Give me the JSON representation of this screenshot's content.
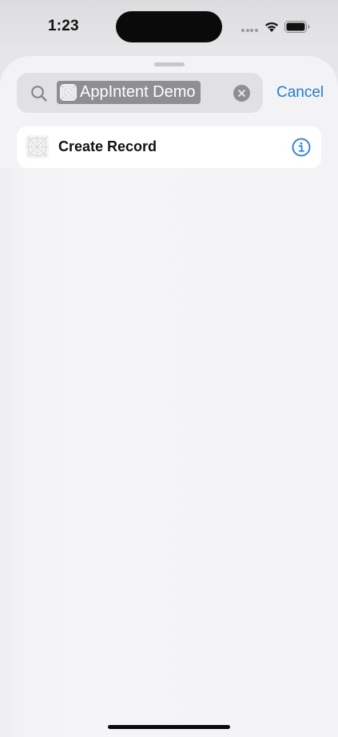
{
  "status_bar": {
    "time": "1:23",
    "wifi_icon": "wifi-icon",
    "battery_icon": "battery-icon"
  },
  "search": {
    "token_label": "AppIntent Demo",
    "token_icon": "app-placeholder-icon",
    "search_icon": "magnifying-glass-icon",
    "clear_icon": "xmark-circle-icon",
    "cancel_label": "Cancel"
  },
  "results": [
    {
      "label": "Create Record",
      "icon": "app-placeholder-icon",
      "info_icon": "info-circle-icon"
    }
  ],
  "colors": {
    "accent": "#1a7cf5",
    "token_background": "#8e8e93",
    "sheet_background": "#f3f3f6"
  }
}
